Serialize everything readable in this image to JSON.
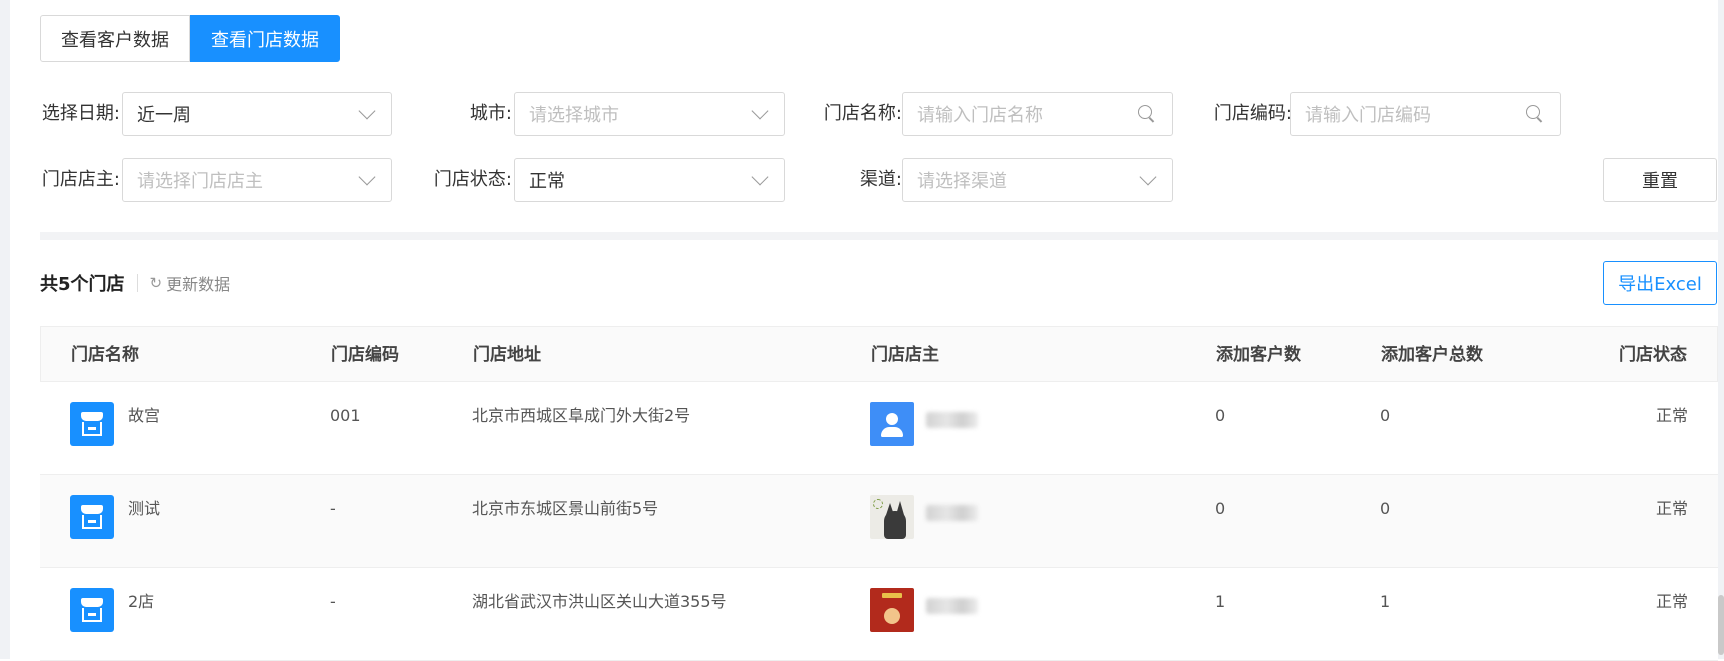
{
  "tabs": [
    "查看客户数据",
    "查看门店数据"
  ],
  "filters": {
    "date": {
      "label": "选择日期:",
      "value": "近一周"
    },
    "city": {
      "label": "城市:",
      "placeholder": "请选择城市"
    },
    "store_name": {
      "label": "门店名称:",
      "placeholder": "请输入门店名称"
    },
    "store_code": {
      "label": "门店编码:",
      "placeholder": "请输入门店编码"
    },
    "owner": {
      "label": "门店店主:",
      "placeholder": "请选择门店店主"
    },
    "status": {
      "label": "门店状态:",
      "value": "正常"
    },
    "channel": {
      "label": "渠道:",
      "placeholder": "请选择渠道"
    },
    "reset_label": "重置"
  },
  "summary": {
    "count_text": "共5个门店",
    "refresh_label": "更新数据",
    "export_label": "导出Excel"
  },
  "table": {
    "headers": [
      "门店名称",
      "门店编码",
      "门店地址",
      "门店店主",
      "添加客户数",
      "添加客户总数",
      "门店状态"
    ],
    "rows": [
      {
        "name": "故宫",
        "code": "001",
        "address": "北京市西城区阜成门外大街2号",
        "added": "0",
        "total": "0",
        "status": "正常"
      },
      {
        "name": "测试",
        "code": "-",
        "address": "北京市东城区景山前街5号",
        "added": "0",
        "total": "0",
        "status": "正常"
      },
      {
        "name": "2店",
        "code": "-",
        "address": "湖北省武汉市洪山区关山大道355号",
        "added": "1",
        "total": "1",
        "status": "正常"
      }
    ]
  },
  "colors": {
    "accent": "#1890ff"
  }
}
